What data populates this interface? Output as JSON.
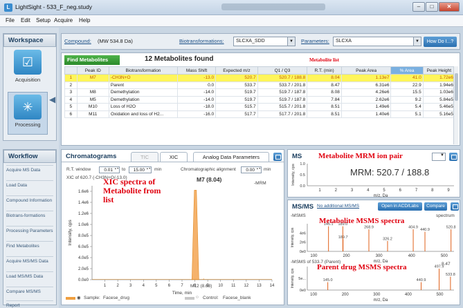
{
  "window": {
    "title": "LightSight - 533_F_neg.study",
    "icon": "lightsight-app-icon",
    "controls": [
      "minimize",
      "maximize",
      "close"
    ]
  },
  "menu": [
    "File",
    "Edit",
    "Setup",
    "Acquire",
    "Help"
  ],
  "workspace": {
    "title": "Workspace",
    "items": [
      {
        "label": "Acquisition",
        "icon": "checkbox-icon"
      },
      {
        "label": "Processing",
        "icon": "processing-icon"
      }
    ]
  },
  "workflow": {
    "title": "Workflow",
    "items": [
      "Acquire MS Data",
      "Load Data",
      "Compound Information",
      "Biotrans-formations",
      "Processing Parameters",
      "Find Metabolites",
      "Acquire MS/MS Data",
      "Load MS/MS Data",
      "Compare MS/MS",
      "Report"
    ]
  },
  "topbar": {
    "compound_label": "Compound:",
    "compound_value": "(MW 534.8 Da)",
    "biotrans_label": "Biotransformations:",
    "biotrans_value": "SLCXA_SDD",
    "params_label": "Parameters:",
    "params_value": "SLCXA",
    "how_button": "How Do I...?"
  },
  "metabolites": {
    "find_button": "Find Metabolites",
    "found_text": "12 Metabolites found",
    "annotation": "Metabolite list",
    "columns": [
      "",
      "Peak ID",
      "Biotransformation",
      "Mass Shift",
      "Expected m/z",
      "Q1 / Q3",
      "R.T. (min)",
      "Peak Area",
      "% Area",
      "Peak Height"
    ],
    "rows": [
      [
        "1",
        "M7",
        "-CH3N+O",
        "-13.0",
        "520.7",
        "520.7 / 188.8",
        "8.04",
        "1.13e7",
        "41.0",
        "1.72e6"
      ],
      [
        "2",
        "",
        "Parent",
        "0.0",
        "533.7",
        "533.7 / 201.8",
        "8.47",
        "6.31e6",
        "22.9",
        "1.94e6"
      ],
      [
        "3",
        "M8",
        "Demethylation",
        "-14.0",
        "519.7",
        "519.7 / 187.8",
        "8.08",
        "4.26e6",
        "15.5",
        "1.03e6"
      ],
      [
        "4",
        "M5",
        "Demethylation",
        "-14.0",
        "519.7",
        "519.7 / 187.8",
        "7.84",
        "2.62e6",
        "9.2",
        "5.84e5"
      ],
      [
        "5",
        "M10",
        "Loss of H2O",
        "-18.0",
        "515.7",
        "515.7 / 201.8",
        "8.51",
        "1.49e6",
        "5.4",
        "5.46e5"
      ],
      [
        "6",
        "M11",
        "Oxidation and loss of H2...",
        "-16.0",
        "517.7",
        "517.7 / 201.8",
        "8.51",
        "1.40e6",
        "5.1",
        "5.16e5"
      ]
    ]
  },
  "chromatogram": {
    "title": "Chromatograms",
    "tabs": [
      "TIC",
      "XIC"
    ],
    "analog_tab": "Analog Data Parameters",
    "rt_window_label": "R.T. window",
    "rt_from": "0.01",
    "to_label": "to",
    "rt_to": "15.00",
    "min_label": "min",
    "align_label": "Chromatographic alignment",
    "align_value": "0.00",
    "align_unit": "min",
    "xic_label": "XIC of 620.7 (-CH3N+O/-13.0)",
    "mode_label": "-MRM",
    "peak_label": "M7 (8.04)",
    "minor_label": "M12 (8.68)",
    "annotation": "XIC spectra of Metabolite from list",
    "sample_label": "Sample:",
    "sample_value": "Facese_drug",
    "control_label": "Control:",
    "control_value": "Facese_blank"
  },
  "ms_panel": {
    "title": "MS",
    "annotation": "Metabolite MRM ion pair",
    "mrm_text": "MRM: 520.7 / 188.8"
  },
  "msms_panel": {
    "title": "MS/MS",
    "no_link": "No additional MS/MS",
    "open_button": "Open in ACD/Labs",
    "compare_button": "Compare",
    "metab_annotation": "Metabolite MSMS spectra",
    "parent_annotation": "Parent drug MSMS spectra",
    "top_label": "-MSMS",
    "top_right_label": "spectrum",
    "bottom_label": "-MSMS of 533.7 (Parent)",
    "bottom_right_label": "8.47"
  },
  "chart_data": [
    {
      "type": "line",
      "title": "XIC of 620.7 (-CH3N+O/-13.0)",
      "xlabel": "Time, min",
      "ylabel": "Intensity, cps",
      "xlim": [
        0,
        14
      ],
      "ylim": [
        0,
        1700000.0
      ],
      "x_ticks": [
        1,
        2,
        3,
        4,
        5,
        6,
        7,
        8,
        9,
        10,
        11,
        12,
        13,
        14
      ],
      "y_ticks": [
        "0.0e0",
        "2.0e5",
        "4.0e5",
        "6.0e5",
        "8.0e5",
        "1.0e6",
        "1.2e6",
        "1.4e6",
        "1.6e6"
      ],
      "peaks": [
        {
          "x": 8.04,
          "y": 1620000.0
        },
        {
          "x": 8.68,
          "y": 20000.0
        }
      ]
    },
    {
      "type": "bar",
      "title": "MS",
      "xlabel": "m/z, Da",
      "ylabel": "Intensity, cps",
      "x_ticks": [
        1,
        2,
        3,
        4,
        5,
        6,
        7,
        8,
        9
      ],
      "y_ticks": [
        "0.0",
        "0.5",
        "1.0"
      ]
    },
    {
      "type": "bar",
      "title": "-MSMS",
      "xlabel": "m/z, Da",
      "ylabel": "Intensity, cps",
      "xlim": [
        80,
        530
      ],
      "x_ticks": [
        100,
        200,
        300,
        400,
        500
      ],
      "y_ticks": [
        "0e0",
        "2e6",
        "4e6"
      ],
      "peaks": [
        {
          "x": 145.1,
          "y": 4100000.0,
          "label": "145.1"
        },
        {
          "x": 189.7,
          "y": 2000000.0,
          "label": "189.7"
        },
        {
          "x": 189.0,
          "y": 4100000.0,
          "label": "189.0"
        },
        {
          "x": 268.9,
          "y": 3600000.0,
          "label": "268.9"
        },
        {
          "x": 326.2,
          "y": 1700000.0,
          "label": "326.2"
        },
        {
          "x": 404.9,
          "y": 3600000.0,
          "label": "404.9"
        },
        {
          "x": 440.9,
          "y": 3200000.0,
          "label": "440.9"
        },
        {
          "x": 520.8,
          "y": 3600000.0,
          "label": "520.8"
        }
      ]
    },
    {
      "type": "bar",
      "title": "-MSMS of 533.7 (Parent)",
      "xlabel": "m/z, Da",
      "ylabel": "Intensity, cps",
      "xlim": [
        80,
        545
      ],
      "x_ticks": [
        100,
        200,
        300,
        400,
        500
      ],
      "y_ticks": [
        "0e0",
        "5e..."
      ],
      "peaks": [
        {
          "x": 145.0,
          "y": 1.0,
          "label": "145.0"
        },
        {
          "x": 440.9,
          "y": 1.0,
          "label": "440.9"
        },
        {
          "x": 497.9,
          "y": 2.7,
          "label": "497.9"
        },
        {
          "x": 533.8,
          "y": 1.7,
          "label": "533.8"
        }
      ]
    }
  ]
}
